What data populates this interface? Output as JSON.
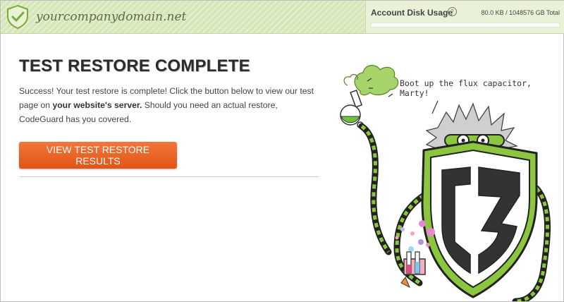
{
  "header": {
    "domain": "yourcompanydomain.net",
    "disk_usage_label": "Account Disk Usage",
    "help_icon": "?",
    "disk_usage_value": "80.0 KB / 1048576 GB Total",
    "disk_usage_fraction": 0.0
  },
  "main": {
    "title": "TEST RESTORE COMPLETE",
    "description_part1": "Success! Your test restore is complete! Click the button below to view our test page on ",
    "description_bold": "your website's server.",
    "description_part2": " Should you need an actual restore, CodeGuard has you covered.",
    "button_label": "VIEW TEST RESTORE RESULTS"
  },
  "illustration": {
    "speech_text": "Boot up the flux capacitor, Marty!"
  },
  "colors": {
    "accent_green": "#8cc63f",
    "button_orange": "#f06a2c",
    "header_green": "#d6e6b8"
  },
  "icons": {
    "logo": "shield-check-icon",
    "help": "question-circle-icon"
  }
}
